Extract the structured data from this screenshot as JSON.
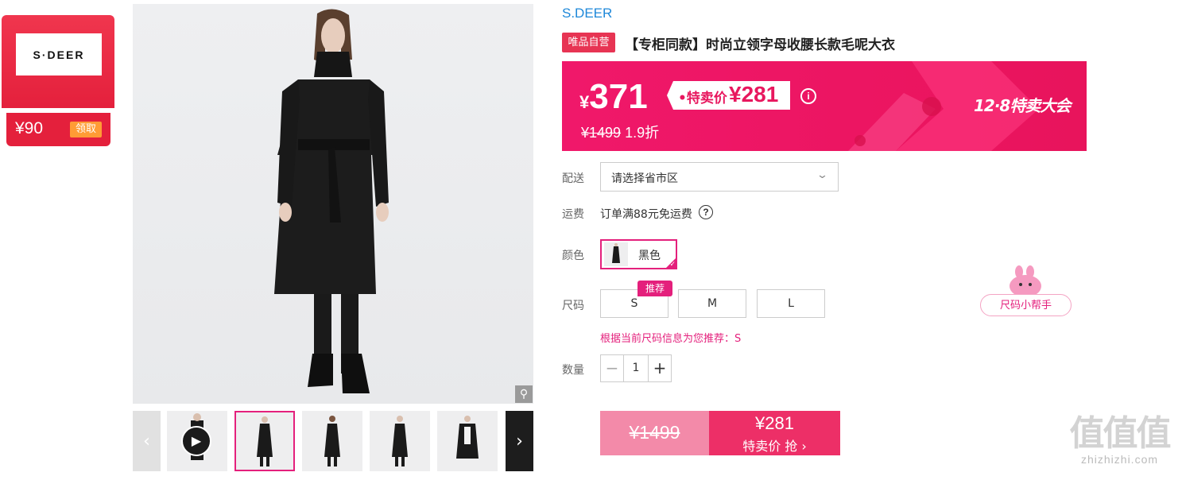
{
  "coupon": {
    "logo_text": "S·DEER",
    "amount": "¥90",
    "claim_label": "领取"
  },
  "gallery": {
    "zoom_icon": "magnifier-icon",
    "prev_icon": "chevron-left-icon",
    "next_icon": "chevron-right-icon",
    "play_icon": "play-icon",
    "thumbnail_count": 5,
    "active_index": 1
  },
  "product": {
    "brand": "S.DEER",
    "self_badge": "唯品自营",
    "title": "【专柜同款】时尚立领字母收腰长款毛呢大衣"
  },
  "price": {
    "currency": "¥",
    "current": "371",
    "sale_label": "•特卖价",
    "sale_price": "¥281",
    "original": "¥1499",
    "discount": "1.9折",
    "event": "12·8特卖大会",
    "accent": "#ec1562"
  },
  "delivery": {
    "label": "配送",
    "placeholder": "请选择省市区",
    "shipping_label": "运费",
    "shipping_text": "订单满88元免运费"
  },
  "color": {
    "label": "颜色",
    "options": [
      {
        "name": "黑色",
        "selected": true
      }
    ]
  },
  "size": {
    "label": "尺码",
    "options": [
      "S",
      "M",
      "L"
    ],
    "recommend_tag": "推荐",
    "hint": "根据当前尺码信息为您推荐：S",
    "helper": "尺码小帮手"
  },
  "quantity": {
    "label": "数量",
    "value": "1",
    "minus": "−",
    "plus": "+"
  },
  "buy": {
    "original": "¥1499",
    "price": "¥281",
    "action": "特卖价 抢 ›",
    "accent": "#ed2f67"
  },
  "watermark": {
    "big": "值值值",
    "small": "zhizhizhi.com"
  }
}
